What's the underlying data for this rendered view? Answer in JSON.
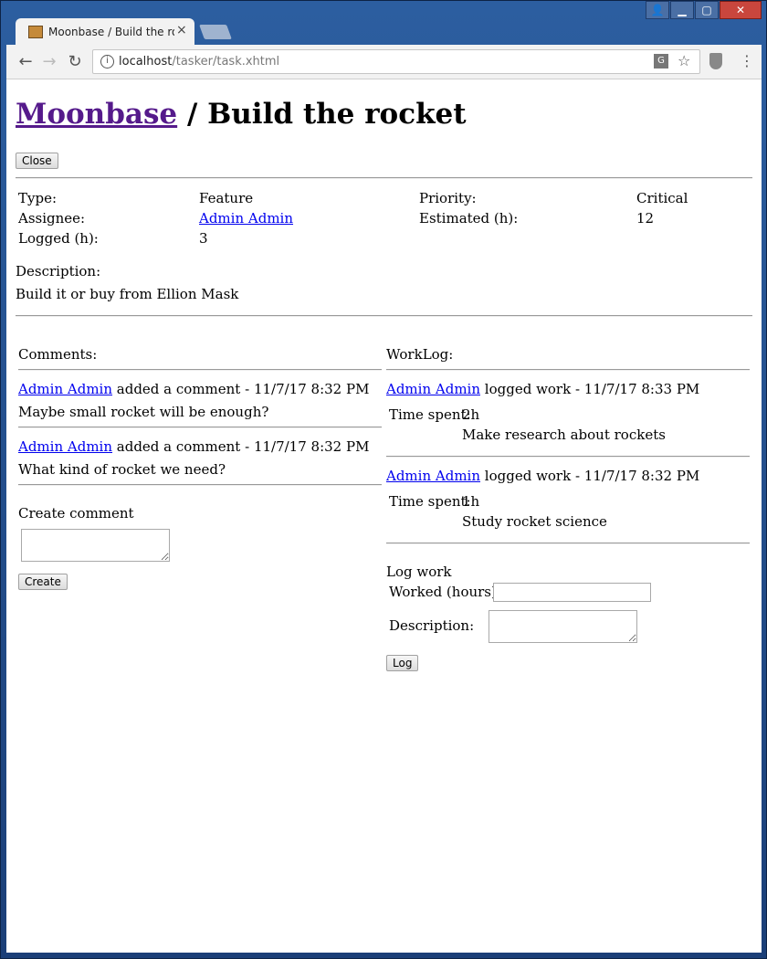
{
  "browser": {
    "tab_title": "Moonbase / Build the rocket",
    "tab_close": "×",
    "url_host": "localhost",
    "url_path": "/tasker/task.xhtml"
  },
  "page": {
    "project_link": "Moonbase",
    "title_suffix": " / Build the rocket",
    "close_button": "Close",
    "details": {
      "type_label": "Type:",
      "type_value": "Feature",
      "priority_label": "Priority:",
      "priority_value": "Critical",
      "assignee_label": "Assignee:",
      "assignee_value": "Admin Admin",
      "estimated_label": "Estimated (h):",
      "estimated_value": "12",
      "logged_label": "Logged (h):",
      "logged_value": "3"
    },
    "description_label": "Description:",
    "description_text": "Build it or buy from Ellion Mask"
  },
  "comments": {
    "header": "Comments:",
    "items": [
      {
        "author": "Admin Admin",
        "meta": " added a comment - 11/7/17 8:32 PM",
        "text": "Maybe small rocket will be enough?"
      },
      {
        "author": "Admin Admin",
        "meta": " added a comment - 11/7/17 8:32 PM",
        "text": "What kind of rocket we need?"
      }
    ],
    "create_label": "Create comment",
    "create_button": "Create"
  },
  "worklog": {
    "header": "WorkLog:",
    "items": [
      {
        "author": "Admin Admin",
        "meta": " logged work - 11/7/17 8:33 PM",
        "time_label": "Time spent:",
        "time_value": "2h",
        "description": "Make research about rockets"
      },
      {
        "author": "Admin Admin",
        "meta": " logged work - 11/7/17 8:32 PM",
        "time_label": "Time spent:",
        "time_value": "1h",
        "description": "Study rocket science"
      }
    ],
    "log_label": "Log work",
    "hours_label": "Worked (hours):",
    "description_label": "Description:",
    "log_button": "Log"
  }
}
